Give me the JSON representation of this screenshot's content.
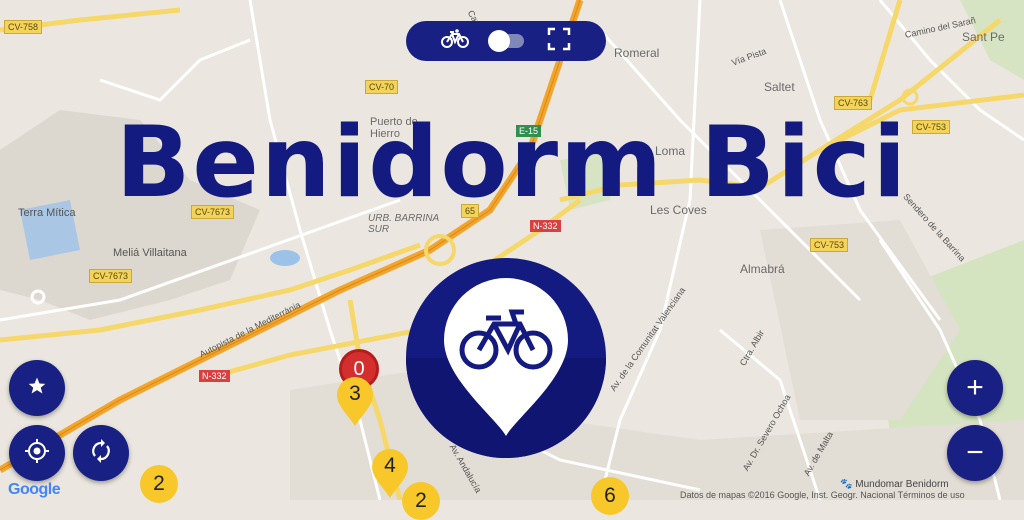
{
  "app": {
    "title": "Benidorm Bici"
  },
  "top_controls": {
    "bike_icon": "bike-icon",
    "toggle_on": false,
    "fullscreen_icon": "fullscreen-icon"
  },
  "fab": {
    "favorites_icon": "star-icon",
    "locate_icon": "crosshair-icon",
    "refresh_icon": "refresh-icon",
    "zoom_in_label": "+",
    "zoom_out_label": "−"
  },
  "colors": {
    "brand": "#182084",
    "highway": "#f2a52a",
    "cluster": "#f8c82a",
    "alert": "#d32f2f"
  },
  "markers": [
    {
      "label": "0",
      "kind": "red-circle"
    },
    {
      "label": "3",
      "kind": "yellow-pin"
    },
    {
      "label": "2",
      "kind": "yellow-circle"
    },
    {
      "label": "4",
      "kind": "yellow-pin"
    },
    {
      "label": "2",
      "kind": "yellow-circle"
    },
    {
      "label": "6",
      "kind": "yellow-circle"
    }
  ],
  "map_labels": {
    "places": [
      "Terra Mítica",
      "Meliá Villaitana",
      "Puerto de Hierro",
      "URB. BARRINA SUR",
      "Romeral",
      "Saltet",
      "Les Coves",
      "Almabrá",
      "Sant Pe",
      "Loma"
    ],
    "roads": [
      "CV-758",
      "CV-70",
      "CV-763",
      "CV-753",
      "CV-7673",
      "N-332",
      "E-15",
      "65",
      "CV-753",
      "CV-7673"
    ],
    "streets": [
      "Autopista de la Mediterrània",
      "Av. de la Comunitat Valenciana",
      "Camino del Sarañ",
      "Vía Pista",
      "Sendero de la Barrina",
      "Ctra. Albir",
      "Av. Dr. Severo Ochoa",
      "Av. de Malta",
      "Av. Andalucía",
      "Carre"
    ]
  },
  "footer": {
    "google": "Google",
    "attribution": "Datos de mapas ©2016 Google, Inst. Geogr. Nacional   Términos de uso",
    "poi": "Mundomar Benidorm"
  }
}
